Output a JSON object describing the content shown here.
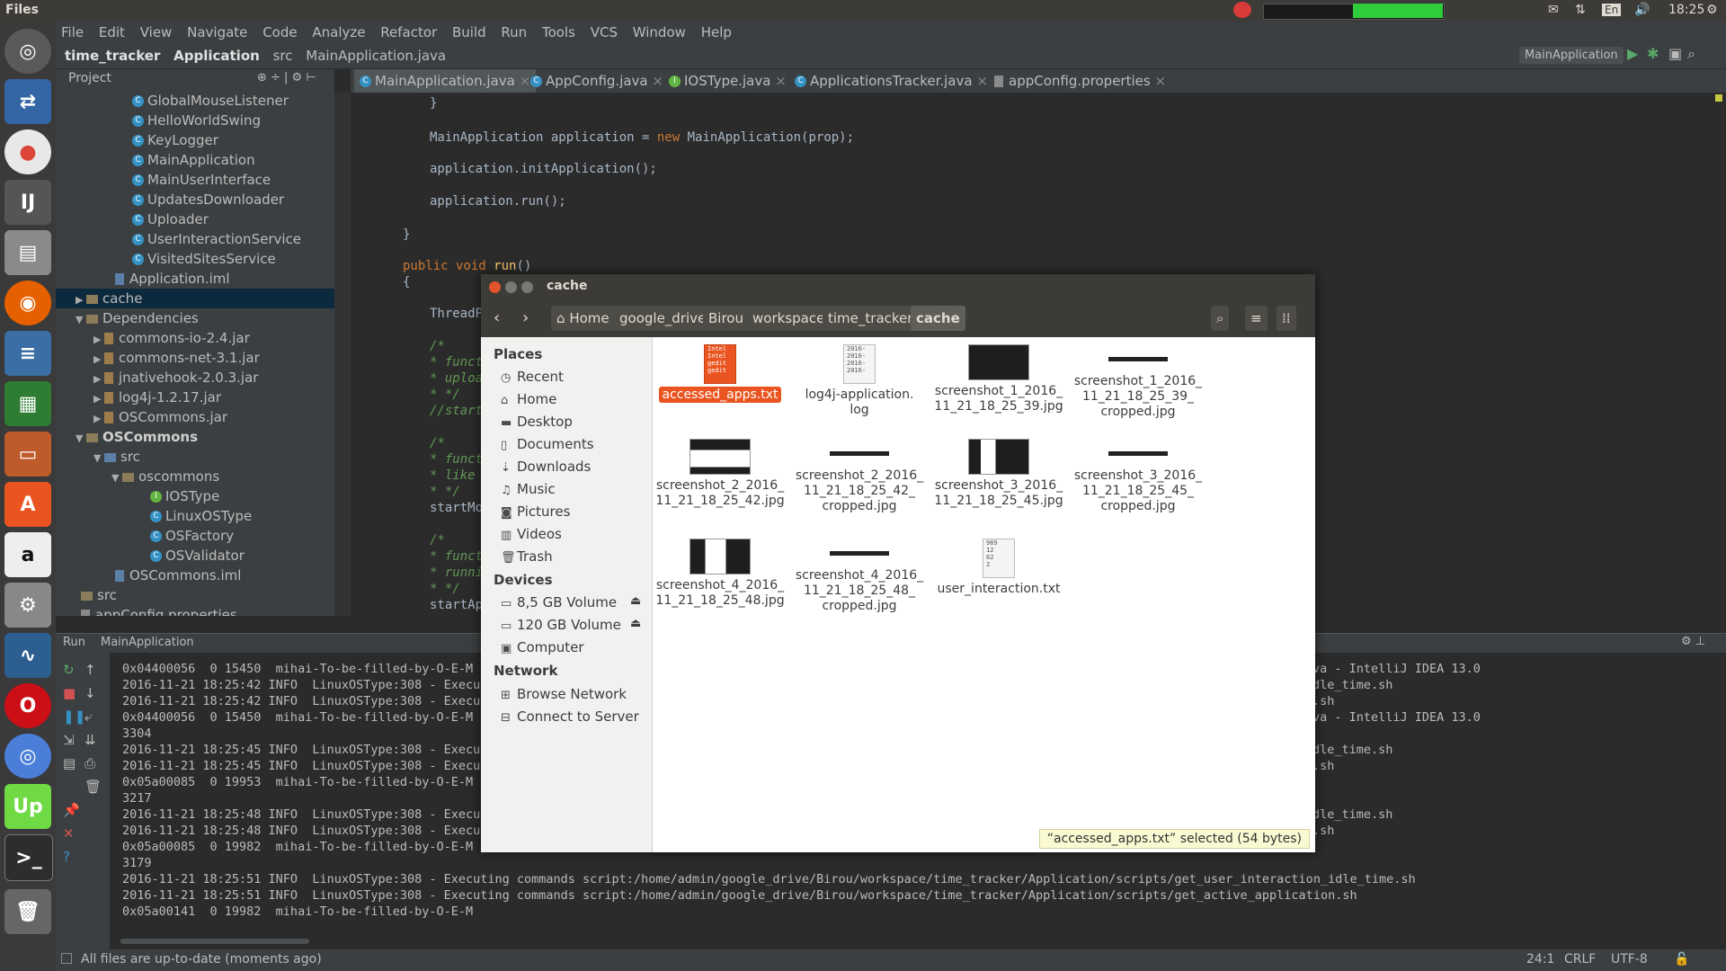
{
  "topbar": {
    "title": "Files",
    "time": "18:25",
    "lang": "En"
  },
  "menu": [
    "File",
    "Edit",
    "View",
    "Navigate",
    "Code",
    "Analyze",
    "Refactor",
    "Build",
    "Run",
    "Tools",
    "VCS",
    "Window",
    "Help"
  ],
  "nav": {
    "project": "time_tracker",
    "module": "Application",
    "src": "src",
    "file": "MainApplication.java",
    "run_config": "MainApplication"
  },
  "project_panel": {
    "label": "Project"
  },
  "tree": [
    {
      "label": "GlobalMouseListener",
      "kind": "class"
    },
    {
      "label": "HelloWorldSwing",
      "kind": "class"
    },
    {
      "label": "KeyLogger",
      "kind": "class"
    },
    {
      "label": "MainApplication",
      "kind": "class"
    },
    {
      "label": "MainUserInterface",
      "kind": "class"
    },
    {
      "label": "UpdatesDownloader",
      "kind": "class"
    },
    {
      "label": "Uploader",
      "kind": "class"
    },
    {
      "label": "UserInteractionService",
      "kind": "class"
    },
    {
      "label": "VisitedSitesService",
      "kind": "class"
    },
    {
      "label": "Application.iml",
      "kind": "iml"
    },
    {
      "label": "cache",
      "kind": "folder"
    },
    {
      "label": "Dependencies",
      "kind": "folder"
    },
    {
      "label": "commons-io-2.4.jar",
      "kind": "jar"
    },
    {
      "label": "commons-net-3.1.jar",
      "kind": "jar"
    },
    {
      "label": "jnativehook-2.0.3.jar",
      "kind": "jar"
    },
    {
      "label": "log4j-1.2.17.jar",
      "kind": "jar"
    },
    {
      "label": "OSCommons.jar",
      "kind": "jar"
    },
    {
      "label": "OSCommons",
      "kind": "module"
    },
    {
      "label": "src",
      "kind": "folder"
    },
    {
      "label": "oscommons",
      "kind": "folder"
    },
    {
      "label": "IOSType",
      "kind": "interface"
    },
    {
      "label": "LinuxOSType",
      "kind": "class"
    },
    {
      "label": "OSFactory",
      "kind": "class"
    },
    {
      "label": "OSValidator",
      "kind": "class"
    },
    {
      "label": "OSCommons.iml",
      "kind": "iml"
    },
    {
      "label": "src",
      "kind": "folder"
    },
    {
      "label": "appConfig.properties",
      "kind": "file"
    }
  ],
  "tabs": [
    "MainApplication.java",
    "AppConfig.java",
    "IOSType.java",
    "ApplicationsTracker.java",
    "appConfig.properties"
  ],
  "code": {
    "l1": "}",
    "l2": "MainApplication application = new MainApplication(prop);",
    "l3": "application.initApplication();",
    "l4": "application.run();",
    "l5": "}",
    "l6": "public void run()",
    "l7": "{",
    "l8": "ThreadP",
    "c1": "/*",
    "c2": "* funct",
    "c3": "* uploa",
    "c4": "* */",
    "c5": "//start",
    "c6": "/*",
    "c7": "* funct",
    "c8": "* like",
    "c9": "* */",
    "c10": "startMo",
    "c11": "/*",
    "c12": "* funct",
    "c13": "* runni",
    "c14": "* */",
    "c15": "startAp"
  },
  "run": {
    "label": "Run",
    "config": "MainApplication"
  },
  "log": [
    "0x04400056  0 15450  mihai-To-be-filled-by-O-E-M t",
    "2016-11-21 18:25:42 INFO  LinuxOSType:308 - Execut",
    "2016-11-21 18:25:42 INFO  LinuxOSType:308 - Execut",
    "0x04400056  0 15450  mihai-To-be-filled-by-O-E-M t",
    "3304",
    "2016-11-21 18:25:45 INFO  LinuxOSType:308 - Execut",
    "2016-11-21 18:25:45 INFO  LinuxOSType:308 - Execut",
    "0x05a00085  0 19953  mihai-To-be-filled-by-O-E-M u",
    "3217",
    "2016-11-21 18:25:48 INFO  LinuxOSType:308 - Execut",
    "2016-11-21 18:25:48 INFO  LinuxOSType:308 - Execut",
    "0x05a00085  0 19982  mihai-To-be-filled-by-O-E-M a",
    "3179",
    "2016-11-21 18:25:51 INFO  LinuxOSType:308 - Executing commands script:/home/admin/google_drive/Birou/workspace/time_tracker/Application/scripts/get_user_interaction_idle_time.sh",
    "2016-11-21 18:25:51 INFO  LinuxOSType:308 - Executing commands script:/home/admin/google_drive/Birou/workspace/time_tracker/Application/scripts/get_active_application.sh",
    "0x05a00141  0 19982  mihai-To-be-filled-by-O-E-M"
  ],
  "log_right": [
    "va - IntelliJ IDEA 13.0",
    "dle_time.sh",
    ".sh",
    "va - IntelliJ IDEA 13.0",
    "",
    "dle_time.sh",
    ".sh",
    "",
    "",
    "dle_time.sh",
    ".sh"
  ],
  "status": {
    "msg": "All files are up-to-date (moments ago)",
    "pos": "24:1",
    "eol": "CRLF",
    "enc": "UTF-8"
  },
  "fm": {
    "title": "cache",
    "path": [
      "Home",
      "google_drive",
      "Birou",
      "workspace",
      "time_tracker",
      "cache"
    ],
    "places_head": "Places",
    "places": [
      {
        "label": "Recent",
        "icon": "clock-icon"
      },
      {
        "label": "Home",
        "icon": "home-icon"
      },
      {
        "label": "Desktop",
        "icon": "desktop-icon"
      },
      {
        "label": "Documents",
        "icon": "documents-icon"
      },
      {
        "label": "Downloads",
        "icon": "download-icon"
      },
      {
        "label": "Music",
        "icon": "music-icon"
      },
      {
        "label": "Pictures",
        "icon": "camera-icon"
      },
      {
        "label": "Videos",
        "icon": "video-icon"
      },
      {
        "label": "Trash",
        "icon": "trash-icon"
      }
    ],
    "devices_head": "Devices",
    "devices": [
      {
        "label": "8,5 GB Volume",
        "icon": "drive-icon"
      },
      {
        "label": "120 GB Volume",
        "icon": "drive-icon"
      },
      {
        "label": "Computer",
        "icon": "computer-icon"
      }
    ],
    "network_head": "Network",
    "network": [
      {
        "label": "Browse Network",
        "icon": "network-icon"
      },
      {
        "label": "Connect to Server",
        "icon": "server-icon"
      }
    ],
    "files": [
      {
        "name": "accessed_apps.txt",
        "type": "txt-selected"
      },
      {
        "name": "log4j-application.\nlog",
        "type": "log"
      },
      {
        "name": "screenshot_1_2016_\n11_21_18_25_39.jpg",
        "type": "img"
      },
      {
        "name": "screenshot_1_2016_\n11_21_18_25_39_\ncropped.jpg",
        "type": "thin"
      },
      {
        "name": "screenshot_2_2016_\n11_21_18_25_42.jpg",
        "type": "img"
      },
      {
        "name": "screenshot_2_2016_\n11_21_18_25_42_\ncropped.jpg",
        "type": "thin"
      },
      {
        "name": "screenshot_3_2016_\n11_21_18_25_45.jpg",
        "type": "img"
      },
      {
        "name": "screenshot_3_2016_\n11_21_18_25_45_\ncropped.jpg",
        "type": "thin"
      },
      {
        "name": "screenshot_4_2016_\n11_21_18_25_48.jpg",
        "type": "img"
      },
      {
        "name": "screenshot_4_2016_\n11_21_18_25_48_\ncropped.jpg",
        "type": "thin"
      },
      {
        "name": "user_interaction.txt",
        "type": "txt"
      }
    ],
    "status": "“accessed_apps.txt” selected  (54 bytes)"
  }
}
